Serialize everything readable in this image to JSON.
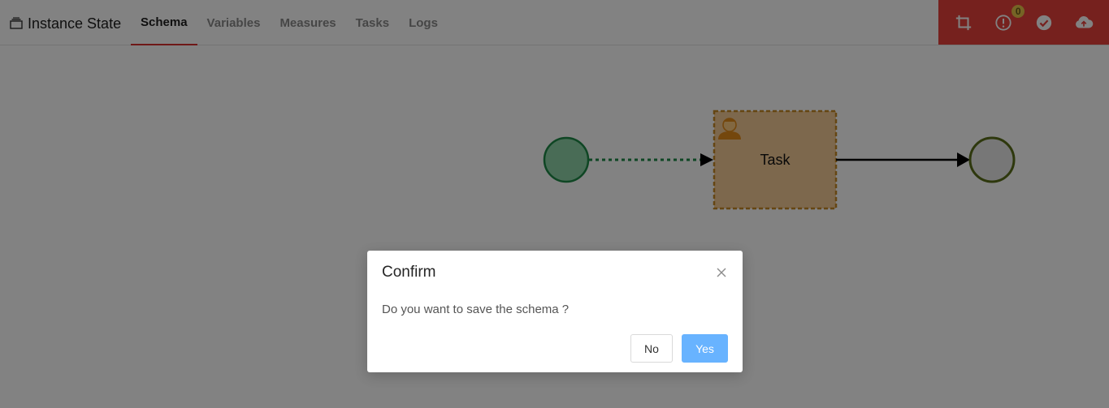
{
  "header": {
    "title": "Instance State",
    "tabs": [
      {
        "label": "Schema",
        "active": true
      },
      {
        "label": "Variables",
        "active": false
      },
      {
        "label": "Measures",
        "active": false
      },
      {
        "label": "Tasks",
        "active": false
      },
      {
        "label": "Logs",
        "active": false
      }
    ],
    "actions": {
      "crop_icon": "crop-icon",
      "alert_icon": "alert-circle-icon",
      "alert_count": "0",
      "check_icon": "check-circle-icon",
      "upload_icon": "cloud-upload-icon"
    }
  },
  "diagram": {
    "task_label": "Task",
    "task_icon": "user-task-icon",
    "start_color": "#8fd4a9",
    "end_color": "#eaeaea",
    "task_fill": "#f6cd97",
    "task_border": "#c78a26",
    "dashed_flow_color": "#1e8a47"
  },
  "modal": {
    "title": "Confirm",
    "message": "Do you want to save the schema ?",
    "no_label": "No",
    "yes_label": "Yes"
  },
  "colors": {
    "accent_red": "#e8413b",
    "primary_blue": "#68b3ff",
    "badge_yellow": "#e7c54a"
  }
}
